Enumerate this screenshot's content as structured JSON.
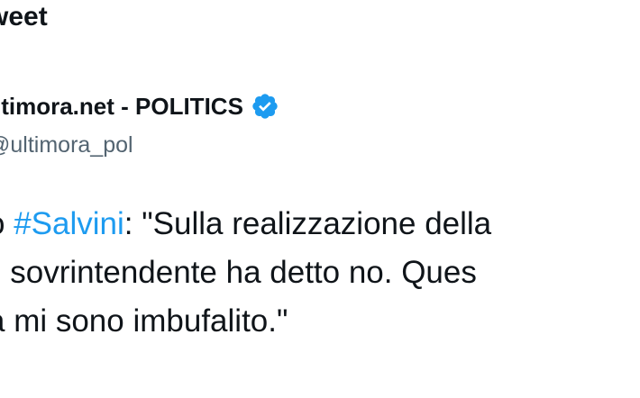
{
  "header": {
    "title": "weet"
  },
  "author": {
    "name": "ltimora.net - POLITICS",
    "handle": "ultimora_pol",
    "verified_icon": "verified-badge-icon",
    "verified_color": "#1d9bf0"
  },
  "tweet": {
    "line1_prefix": "o ",
    "hashtag": "#Salvini",
    "line1_suffix": ": \"Sulla realizzazione della",
    "line2": "il sovrintendente ha detto no. Ques",
    "line3": "a mi sono imbufalito.\""
  },
  "colors": {
    "text": "#0f1419",
    "secondary": "#536471",
    "link": "#1d9bf0"
  }
}
